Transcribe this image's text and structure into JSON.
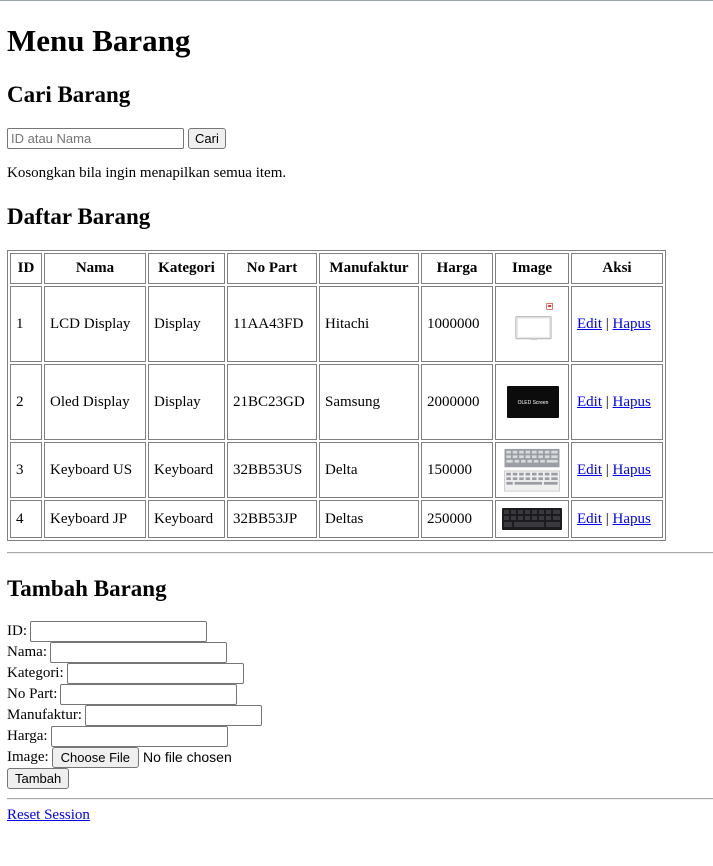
{
  "page": {
    "title": "Menu Barang"
  },
  "search": {
    "heading": "Cari Barang",
    "placeholder": "ID atau Nama",
    "value": "",
    "button_label": "Cari",
    "hint": "Kosongkan bila ingin menapilkan semua item."
  },
  "list": {
    "heading": "Daftar Barang",
    "columns": [
      "ID",
      "Nama",
      "Kategori",
      "No Part",
      "Manufaktur",
      "Harga",
      "Image",
      "Aksi"
    ],
    "rows": [
      {
        "id": "1",
        "nama": "LCD Display",
        "kategori": "Display",
        "no_part": "11AA43FD",
        "manufaktur": "Hitachi",
        "harga": "1000000",
        "image": "lcd-panel-icon",
        "edit": "Edit",
        "sep": "|",
        "hapus": "Hapus"
      },
      {
        "id": "2",
        "nama": "Oled Display",
        "kategori": "Display",
        "no_part": "21BC23GD",
        "manufaktur": "Samsung",
        "harga": "2000000",
        "image": "oled-screen-icon",
        "image_text": "OLED Screen",
        "edit": "Edit",
        "sep": "|",
        "hapus": "Hapus"
      },
      {
        "id": "3",
        "nama": "Keyboard US",
        "kategori": "Keyboard",
        "no_part": "32BB53US",
        "manufaktur": "Delta",
        "harga": "150000",
        "image": "keyboard-icon",
        "edit": "Edit",
        "sep": "|",
        "hapus": "Hapus"
      },
      {
        "id": "4",
        "nama": "Keyboard JP",
        "kategori": "Keyboard",
        "no_part": "32BB53JP",
        "manufaktur": "Deltas",
        "harga": "250000",
        "image": "keyboard-black-icon",
        "edit": "Edit",
        "sep": "|",
        "hapus": "Hapus"
      }
    ]
  },
  "add_form": {
    "heading": "Tambah Barang",
    "fields": [
      {
        "label": "ID:",
        "value": ""
      },
      {
        "label": "Nama:",
        "value": ""
      },
      {
        "label": "Kategori:",
        "value": ""
      },
      {
        "label": "No Part:",
        "value": ""
      },
      {
        "label": "Manufaktur:",
        "value": ""
      },
      {
        "label": "Harga:",
        "value": ""
      }
    ],
    "image_label": "Image:",
    "file_button": "Choose File",
    "file_status": "No file chosen",
    "submit_label": "Tambah"
  },
  "footer": {
    "reset_link": "Reset Session"
  }
}
